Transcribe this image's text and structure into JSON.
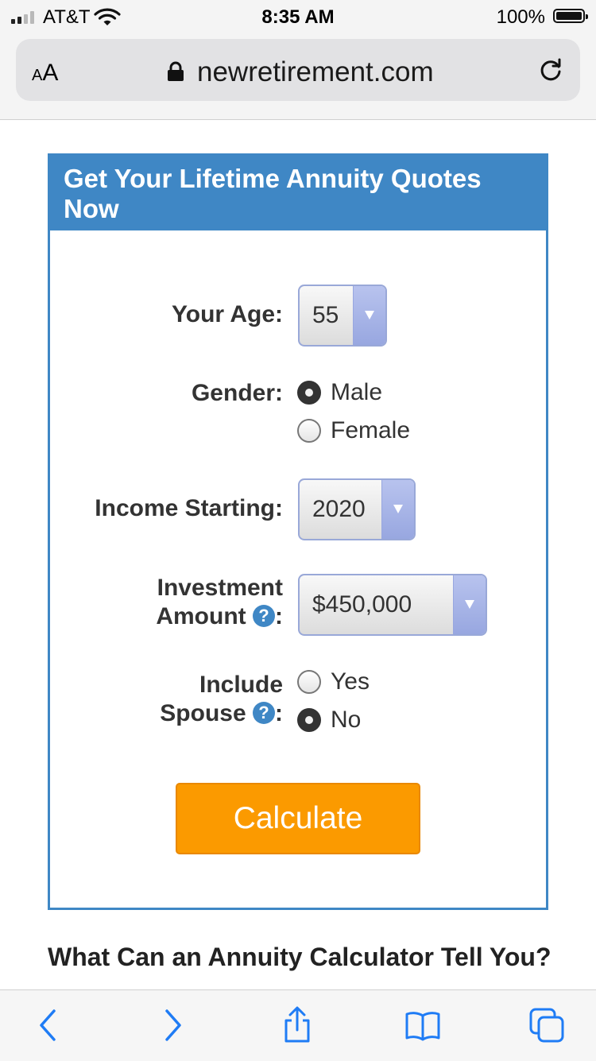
{
  "status_bar": {
    "carrier": "AT&T",
    "time": "8:35 AM",
    "battery": "100%"
  },
  "browser": {
    "aa_small": "A",
    "aa_large": "A",
    "url": "newretirement.com"
  },
  "form": {
    "title": "Get Your Lifetime Annuity Quotes Now",
    "age_label": "Your Age:",
    "age_value": "55",
    "gender_label": "Gender:",
    "gender_options": [
      "Male",
      "Female"
    ],
    "gender_selected": "Male",
    "income_label": "Income Starting:",
    "income_value": "2020",
    "investment_label_1": "Investment",
    "investment_label_2": "Amount",
    "investment_value": "$450,000",
    "spouse_label_1": "Include",
    "spouse_label_2": "Spouse",
    "spouse_options": [
      "Yes",
      "No"
    ],
    "spouse_selected": "No",
    "help_glyph": "?",
    "colon": ":",
    "calculate_label": "Calculate"
  },
  "section": {
    "heading": "What Can an Annuity Calculator Tell You?"
  },
  "icons": {
    "back": "chevron-left-icon",
    "forward": "chevron-right-icon",
    "share": "share-icon",
    "bookmarks": "book-icon",
    "tabs": "tabs-icon"
  },
  "colors": {
    "accent": "#3f87c5",
    "button": "#fb9a00",
    "ios_blue": "#1f7cf5"
  }
}
